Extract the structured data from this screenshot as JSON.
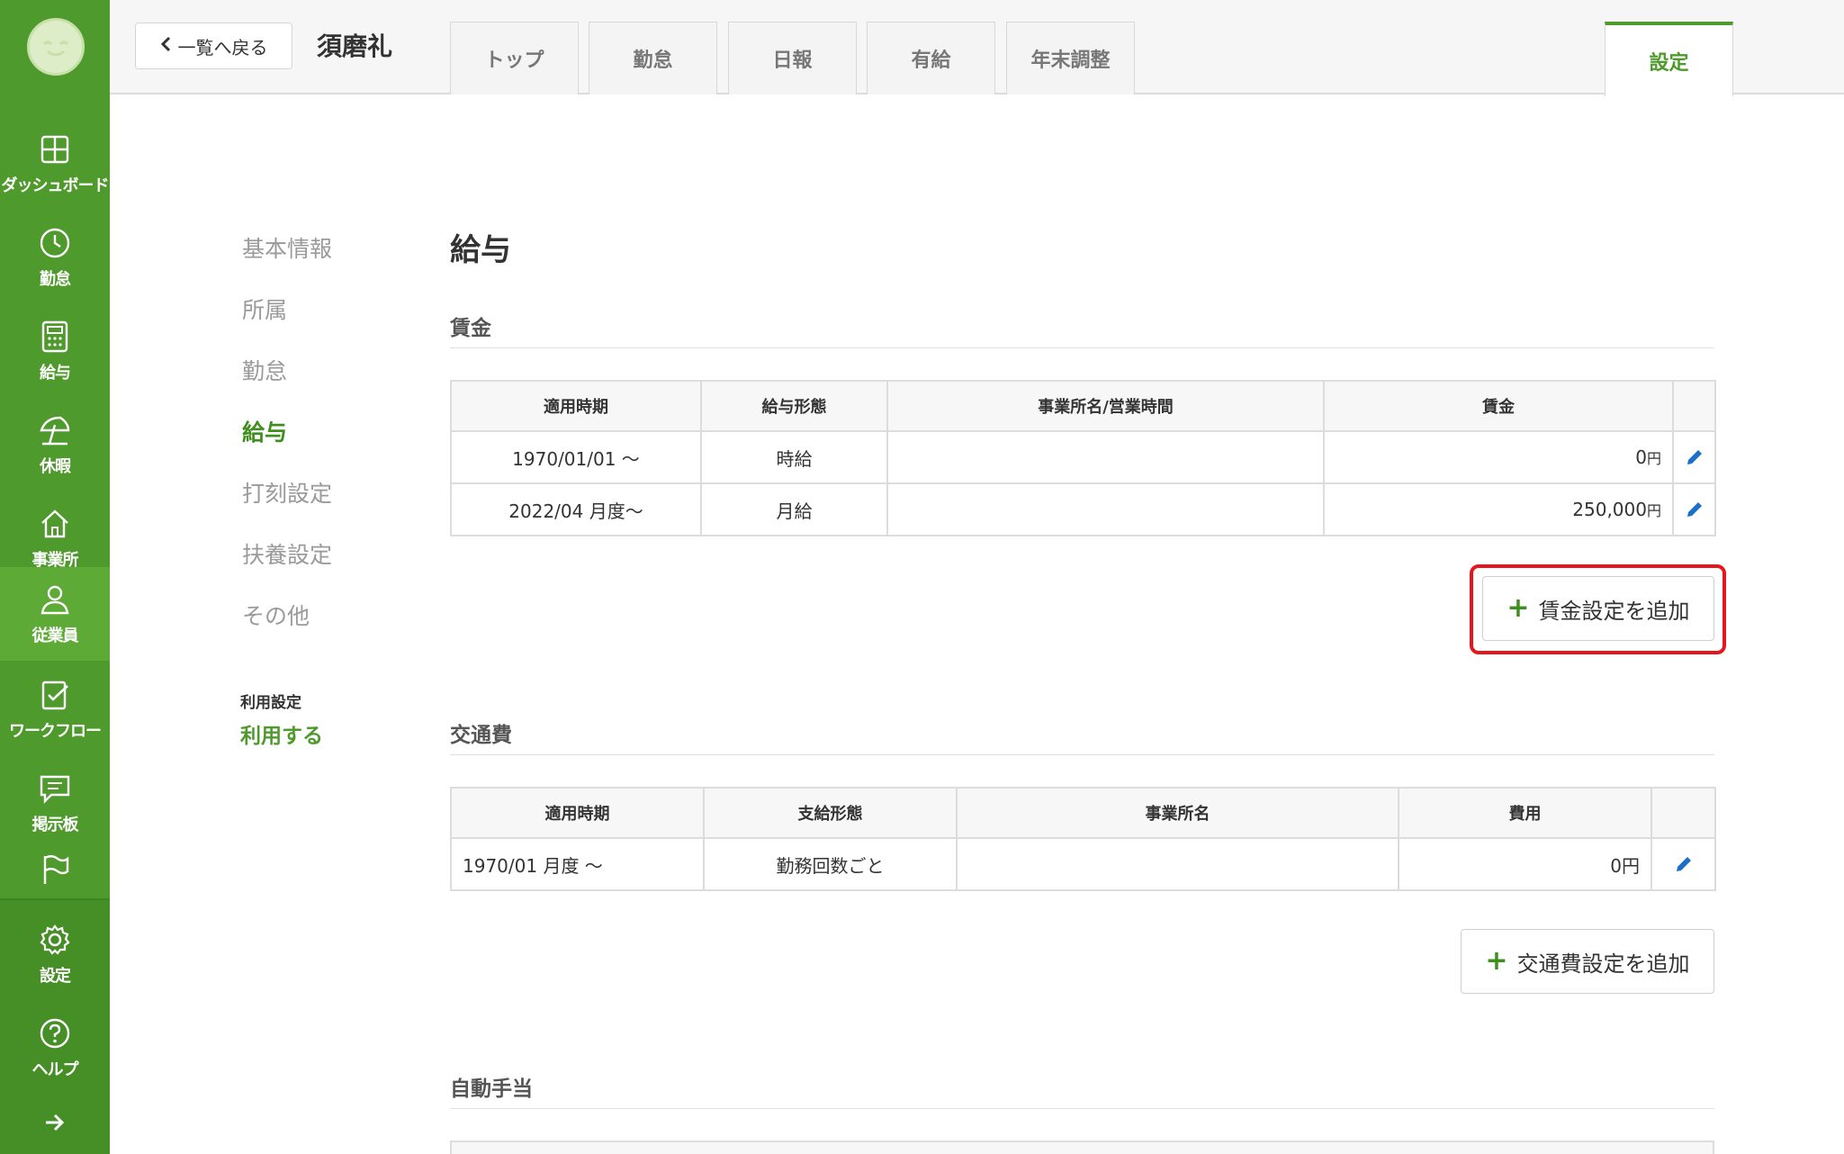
{
  "header": {
    "back_label": "一覧へ戻る",
    "employee_name": "須磨礼",
    "tabs": [
      {
        "label": "トップ"
      },
      {
        "label": "勤怠"
      },
      {
        "label": "日報"
      },
      {
        "label": "有給"
      },
      {
        "label": "年末調整"
      }
    ],
    "settings_tab": "設定"
  },
  "rail": {
    "items": [
      {
        "label": "ダッシュボード",
        "icon": "dashboard-icon"
      },
      {
        "label": "勤怠",
        "icon": "clock-icon"
      },
      {
        "label": "給与",
        "icon": "calculator-icon"
      },
      {
        "label": "休暇",
        "icon": "parasol-icon"
      },
      {
        "label": "事業所",
        "icon": "house-icon"
      },
      {
        "label": "従業員",
        "icon": "person-icon"
      },
      {
        "label": "ワークフロー",
        "icon": "clipboard-check-icon"
      },
      {
        "label": "掲示板",
        "icon": "chat-icon"
      },
      {
        "label": "",
        "icon": "flag-icon"
      },
      {
        "label": "設定",
        "icon": "gear-icon"
      },
      {
        "label": "ヘルプ",
        "icon": "help-icon"
      },
      {
        "label": "",
        "icon": "arrow-right-icon"
      }
    ]
  },
  "subnav": {
    "items": [
      {
        "label": "基本情報"
      },
      {
        "label": "所属"
      },
      {
        "label": "勤怠"
      },
      {
        "label": "給与"
      },
      {
        "label": "打刻設定"
      },
      {
        "label": "扶養設定"
      },
      {
        "label": "その他"
      }
    ],
    "usage_label": "利用設定",
    "usage_value": "利用する"
  },
  "main": {
    "title": "給与",
    "wage": {
      "title": "賃金",
      "columns": [
        "適用時期",
        "給与形態",
        "事業所名/営業時間",
        "賃金"
      ],
      "rows": [
        {
          "period": "1970/01/01 〜",
          "type": "時給",
          "office": "",
          "amount": "0",
          "unit": "円"
        },
        {
          "period": "2022/04 月度〜",
          "type": "月給",
          "office": "",
          "amount": "250,000",
          "unit": "円"
        }
      ],
      "add_label": "賃金設定を追加"
    },
    "transport": {
      "title": "交通費",
      "columns": [
        "適用時期",
        "支給形態",
        "事業所名",
        "費用"
      ],
      "rows": [
        {
          "period": "1970/01 月度 〜",
          "type": "勤務回数ごと",
          "office": "",
          "amount": "0円"
        }
      ],
      "add_label": "交通費設定を追加"
    },
    "allowance": {
      "title": "自動手当"
    }
  }
}
